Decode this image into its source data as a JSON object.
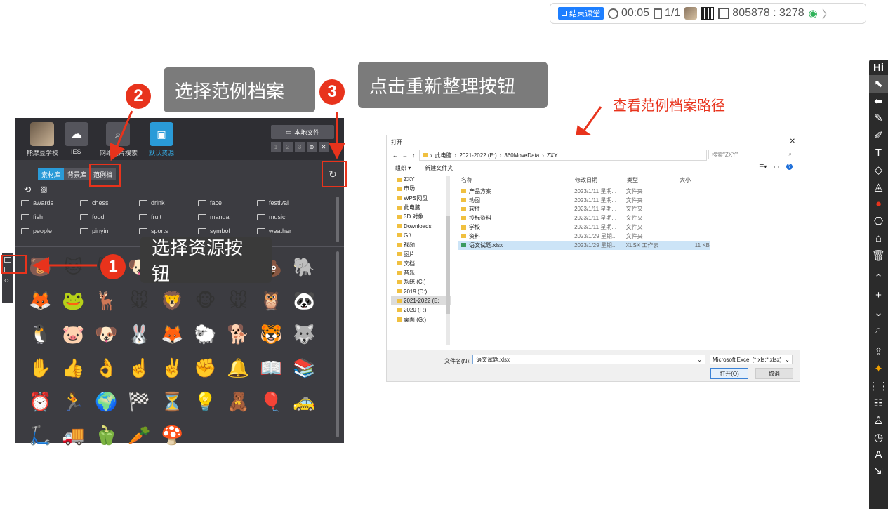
{
  "topbar": {
    "end_class_label": "结束课堂",
    "timer": "00:05",
    "pages": "1/1",
    "class_code": "805878 : 3278"
  },
  "callouts": {
    "step1_number": "1",
    "step1_text": "选择资源按钮",
    "step2_number": "2",
    "step2_text": "选择范例档案",
    "step3_number": "3",
    "step3_text": "点击重新整理按钮",
    "path_note": "查看范例档案路径"
  },
  "panel": {
    "tabs": [
      {
        "label": "熊摩豆学校",
        "icon": "school-avatar-icon"
      },
      {
        "label": "IES",
        "icon": "cloud-icon"
      },
      {
        "label": "网络图片搜索",
        "icon": "image-search-icon"
      },
      {
        "label": "默认资源",
        "icon": "default-resource-icon"
      }
    ],
    "local_file_label": "本地文件",
    "pager": [
      "1",
      "2",
      "3"
    ],
    "sub_tabs": [
      "素材库",
      "背景库",
      "范例档"
    ],
    "folders": [
      "awards",
      "chess",
      "drink",
      "face",
      "festival",
      "fish",
      "food",
      "fruit",
      "manda",
      "music",
      "people",
      "pinyin",
      "sports",
      "symbol",
      "weather"
    ],
    "emoji": [
      "🐻",
      "🐱",
      "🐱",
      "🐶",
      "🐼",
      "🦁",
      "🐷",
      "💩",
      "🐘",
      "🦊",
      "🐸",
      "🦌",
      "🐭",
      "🦁",
      "🐵",
      "🐭",
      "🦉",
      "🐼",
      "🐧",
      "🐷",
      "🐶",
      "🐰",
      "🦊",
      "🐑",
      "🐕",
      "🐯",
      "🐺",
      "✋",
      "👍",
      "👌",
      "☝️",
      "✌️",
      "✊",
      "🔔",
      "📖",
      "📚",
      "⏰",
      "🏃",
      "🌍",
      "🏁",
      "⏳",
      "💡",
      "🧸",
      "🎈",
      "🚕",
      "🛴",
      "🚚",
      "🫑",
      "🥕",
      "🍄"
    ]
  },
  "dialog": {
    "title": "打开",
    "path": [
      "此电脑",
      "2021-2022 (E:)",
      "360MoveData",
      "ZXY"
    ],
    "search_placeholder": "搜索\"ZXY\"",
    "organize": "组织 ▾",
    "new_folder": "新建文件夹",
    "tree": [
      "ZXY",
      "市场",
      "WPS网盘",
      "此电脑",
      "3D 对象",
      "Downloads",
      "G:\\",
      "视频",
      "图片",
      "文档",
      "音乐",
      "系统 (C:)",
      "2019 (D:)",
      "2021-2022 (E:",
      "2020 (F:)",
      "桌面 (G:)"
    ],
    "columns": [
      "名称",
      "修改日期",
      "类型",
      "大小"
    ],
    "files": [
      {
        "name": "产品方案",
        "date": "2023/1/11 星期...",
        "type": "文件夹",
        "size": ""
      },
      {
        "name": "动图",
        "date": "2023/1/11 星期...",
        "type": "文件夹",
        "size": ""
      },
      {
        "name": "软件",
        "date": "2023/1/11 星期...",
        "type": "文件夹",
        "size": ""
      },
      {
        "name": "投标资料",
        "date": "2023/1/11 星期...",
        "type": "文件夹",
        "size": ""
      },
      {
        "name": "学校",
        "date": "2023/1/11 星期...",
        "type": "文件夹",
        "size": ""
      },
      {
        "name": "资料",
        "date": "2023/1/29 星期...",
        "type": "文件夹",
        "size": ""
      },
      {
        "name": "语文试题.xlsx",
        "date": "2023/1/29 星期...",
        "type": "XLSX 工作表",
        "size": "11 KB"
      }
    ],
    "filename_label": "文件名(N):",
    "filename_value": "语文试题.xlsx",
    "filetype": "Microsoft Excel (*.xls;*.xlsx)",
    "open_label": "打开(O)",
    "cancel_label": "取消"
  },
  "right_toolbar": {
    "hi_label": "Hi",
    "tools": [
      "pointer-icon",
      "undo-icon",
      "pen-icon",
      "marker-icon",
      "text-icon",
      "eraser-icon",
      "fill-icon",
      "palette-icon",
      "stamp-icon",
      "clear-icon",
      "delete-icon"
    ],
    "nav": [
      "up-icon",
      "add-icon",
      "down-icon",
      "zoom-icon"
    ],
    "extra": [
      "share-icon",
      "laser-icon",
      "apps-icon",
      "quiz-icon",
      "user-icon",
      "timer-icon",
      "caption-icon",
      "exit-icon"
    ]
  }
}
